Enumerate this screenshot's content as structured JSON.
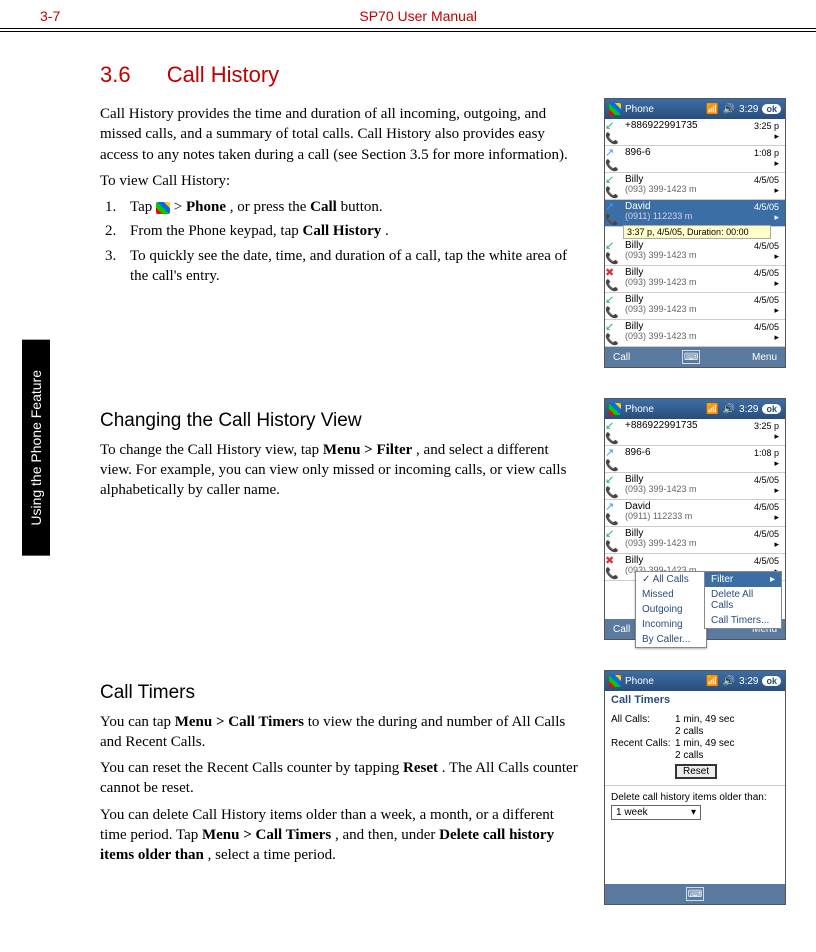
{
  "header": {
    "page": "3-7",
    "title": "SP70 User Manual"
  },
  "sidebar": {
    "label": "Using the Phone Feature"
  },
  "section": {
    "num": "3.6",
    "title": "Call History",
    "intro": "Call History provides the time and duration of all incoming, outgoing, and missed calls, and a summary of total calls. Call History also provides easy access to any notes taken during a call (see Section 3.5 for more information).",
    "view_line": "To view Call History:",
    "steps": {
      "s1a": "Tap ",
      "s1b": " > ",
      "s1_phone": "Phone",
      "s1c": ", or press the ",
      "s1_call": "Call",
      "s1d": " button.",
      "s2a": "From the Phone keypad, tap ",
      "s2b": "Call History",
      "s2c": ".",
      "s3": "To quickly see the date, time, and duration of a call, tap the white area of the call's entry."
    }
  },
  "sub2": {
    "title": "Changing the Call History View",
    "p1a": "To change the Call History view, tap ",
    "p1b": "Menu > Filter",
    "p1c": ", and select a different view. For example, you can view only missed or incoming calls, or view calls alphabetically by caller name."
  },
  "sub3": {
    "title": "Call Timers",
    "p1a": "You can tap ",
    "p1b": "Menu > Call Timers",
    "p1c": " to view the during and number of All Calls and Recent Calls.",
    "p2a": "You can reset the Recent Calls counter by tapping ",
    "p2b": "Reset",
    "p2c": ". The All Calls counter cannot be reset.",
    "p3a": "You can delete Call History items older than a week, a month, or a different time period. Tap ",
    "p3b": "Menu > Call Timers",
    "p3c": ", and then, under ",
    "p3d": "Delete call history items older than",
    "p3e": ", select a time period."
  },
  "phone": {
    "title": "Phone",
    "time": "3:29",
    "ok": "ok",
    "soft_left": "Call",
    "soft_right": "Menu",
    "tooltip": "3:37 p, 4/5/05, Duration: 00:00",
    "rows": [
      {
        "icon": "in",
        "name": "+886922991735",
        "sub": "",
        "time": "3:25 p"
      },
      {
        "icon": "out",
        "name": "896-6",
        "sub": "",
        "time": "1:08 p"
      },
      {
        "icon": "in",
        "name": "Billy",
        "sub": "(093) 399-1423 m",
        "time": "4/5/05"
      },
      {
        "icon": "out",
        "name": "David",
        "sub": "(0911) 112233 m",
        "time": "4/5/05",
        "sel": true
      },
      {
        "icon": "in",
        "name": "Billy",
        "sub": "(093) 399-1423 m",
        "time": "4/5/05"
      },
      {
        "icon": "miss",
        "name": "Billy",
        "sub": "(093) 399-1423 m",
        "time": "4/5/05"
      },
      {
        "icon": "in",
        "name": "Billy",
        "sub": "(093) 399-1423 m",
        "time": "4/5/05"
      },
      {
        "icon": "in",
        "name": "Billy",
        "sub": "(093) 399-1423 m",
        "time": "4/5/05"
      }
    ]
  },
  "filter": {
    "items": [
      "All Calls",
      "Missed",
      "Outgoing",
      "Incoming",
      "By Caller..."
    ],
    "side": {
      "filter": "Filter",
      "del": "Delete All Calls",
      "timers": "Call Timers..."
    }
  },
  "timers": {
    "title": "Call Timers",
    "all_lbl": "All Calls:",
    "all_v1": "1 min, 49 sec",
    "all_v2": "2 calls",
    "recent_lbl": "Recent Calls:",
    "recent_v1": "1 min, 49 sec",
    "recent_v2": "2 calls",
    "reset": "Reset",
    "delete_lbl": "Delete call history items older than:",
    "dd": "1 week"
  }
}
